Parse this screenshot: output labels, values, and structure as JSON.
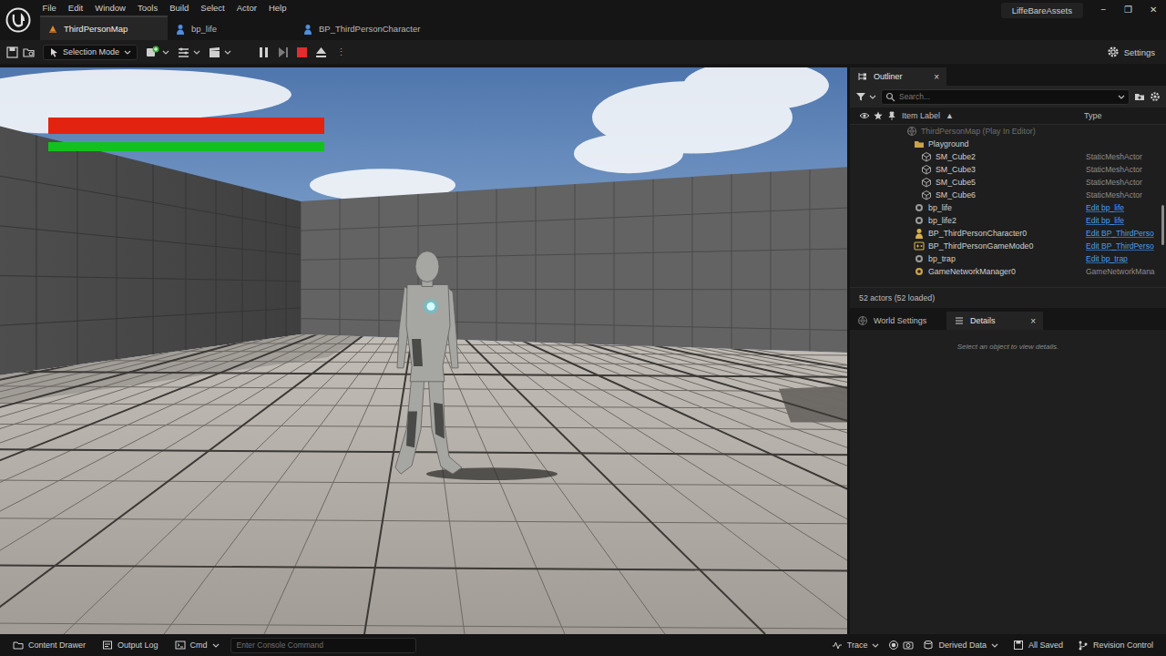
{
  "menu": [
    "File",
    "Edit",
    "Window",
    "Tools",
    "Build",
    "Select",
    "Actor",
    "Help"
  ],
  "tabs": [
    {
      "label": "ThirdPersonMap",
      "selected": true,
      "kind": "level"
    },
    {
      "label": "bp_life",
      "selected": false,
      "kind": "blueprint"
    },
    {
      "label": "BP_ThirdPersonCharacter",
      "selected": false,
      "kind": "blueprint"
    }
  ],
  "project": "LiffeBareAssets",
  "window_controls": [
    "−",
    "❐",
    "✕"
  ],
  "toolbar": {
    "mode": "Selection Mode",
    "more": "⋮",
    "settings": "Settings"
  },
  "hud": [
    {
      "level": 1,
      "color": "#e2230f"
    },
    {
      "level": 1,
      "color": "#12c11e"
    }
  ],
  "outliner": {
    "title": "Outliner",
    "close": "×",
    "search_placeholder": "Search...",
    "columns": [
      "Item Label",
      "Type"
    ],
    "sort_indicator": "▲",
    "rows": [
      {
        "label": "ThirdPersonMap (Play In Editor)",
        "kind": "world"
      },
      {
        "label": "Playground",
        "kind": "folder"
      },
      {
        "label": "SM_Cube2",
        "kind": "mesh",
        "type": "StaticMeshActor",
        "link": false
      },
      {
        "label": "SM_Cube3",
        "kind": "mesh",
        "type": "StaticMeshActor",
        "link": false
      },
      {
        "label": "SM_Cube5",
        "kind": "mesh",
        "type": "StaticMeshActor",
        "link": false
      },
      {
        "label": "SM_Cube6",
        "kind": "mesh",
        "type": "StaticMeshActor",
        "link": false
      },
      {
        "label": "bp_life",
        "kind": "actor",
        "type": "Edit bp_life",
        "link": true
      },
      {
        "label": "bp_life2",
        "kind": "actor",
        "type": "Edit bp_life",
        "link": true
      },
      {
        "label": "BP_ThirdPersonCharacter0",
        "kind": "pawn",
        "type": "Edit BP_ThirdPerso",
        "link": true
      },
      {
        "label": "BP_ThirdPersonGameMode0",
        "kind": "gamemode",
        "type": "Edit BP_ThirdPerso",
        "link": true
      },
      {
        "label": "bp_trap",
        "kind": "actor",
        "type": "Edit bp_trap",
        "link": true
      },
      {
        "label": "GameNetworkManager0",
        "kind": "manager",
        "type": "GameNetworkMana",
        "link": false
      }
    ],
    "status": "52 actors (52 loaded)"
  },
  "details": {
    "tabs": [
      {
        "label": "World Settings",
        "selected": false,
        "kind": "world"
      },
      {
        "label": "Details",
        "selected": true,
        "kind": "details",
        "close": "×"
      }
    ],
    "empty_message": "Select an object to view details."
  },
  "status_bar": {
    "left": [
      {
        "label": "Content Drawer",
        "kind": "drawer",
        "dropdown": false
      },
      {
        "label": "Output Log",
        "kind": "log",
        "dropdown": false
      },
      {
        "label": "Cmd",
        "kind": "cmd",
        "dropdown": true
      }
    ],
    "console_placeholder": "Enter Console Command",
    "right": [
      {
        "label": "Trace",
        "kind": "trace",
        "dropdown": true
      },
      {
        "label": "Derived Data",
        "kind": "data",
        "dropdown": true
      },
      {
        "label": "All Saved",
        "kind": "save",
        "dropdown": false
      },
      {
        "label": "Revision Control",
        "kind": "revision",
        "dropdown": false
      }
    ]
  }
}
